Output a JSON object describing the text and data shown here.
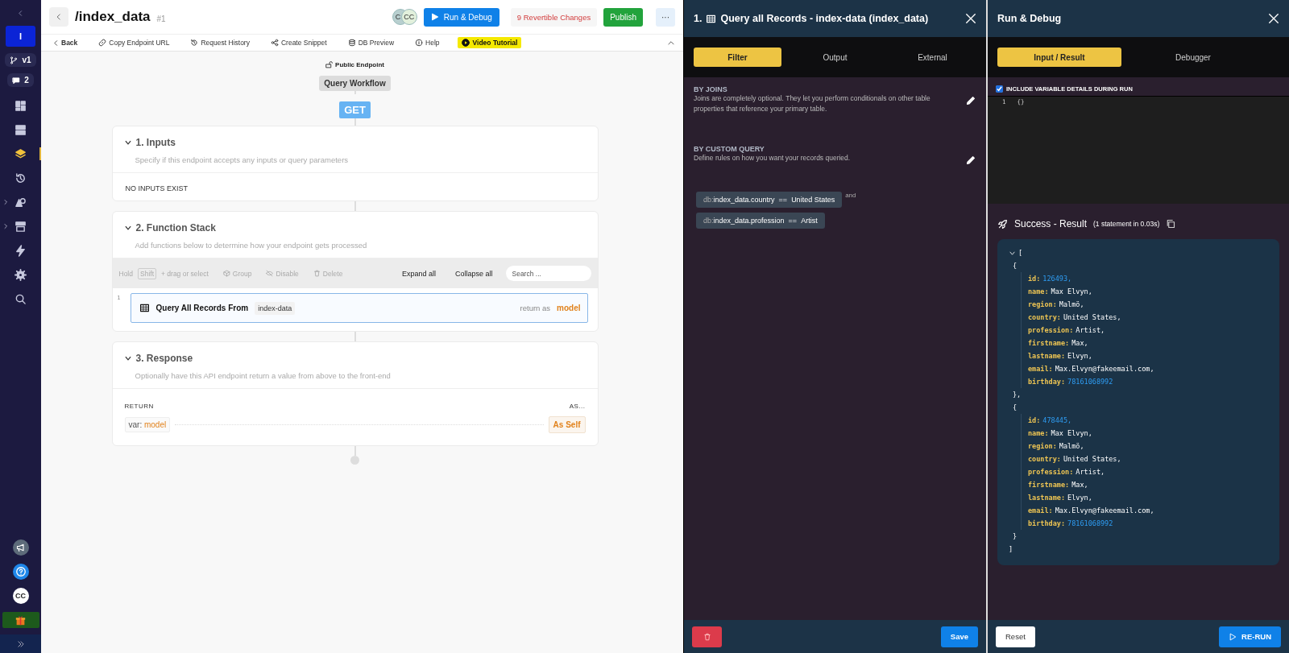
{
  "sidebar": {
    "top": [
      {
        "kind": "workspace",
        "label": "I"
      },
      {
        "kind": "branch",
        "label": "v1"
      },
      {
        "kind": "comments",
        "label": "2"
      }
    ],
    "nav": [
      {
        "selected": false,
        "expandable": false
      },
      {
        "selected": false,
        "expandable": false
      },
      {
        "selected": true,
        "expandable": false
      },
      {
        "selected": false,
        "expandable": false
      },
      {
        "selected": false,
        "expandable": true
      },
      {
        "selected": false,
        "expandable": true
      },
      {
        "selected": false,
        "expandable": false
      },
      {
        "selected": false,
        "expandable": false
      },
      {
        "selected": false,
        "expandable": false
      }
    ],
    "avatar": "CC"
  },
  "header": {
    "title": "/index_data",
    "number": "#1",
    "avatars": [
      "C",
      "CC"
    ],
    "run_button": "Run & Debug",
    "changes": "9 Revertible Changes",
    "publish": "Publish",
    "more": "···"
  },
  "toolbar": [
    {
      "label": "Back",
      "kind": "back"
    },
    {
      "label": "Copy Endpoint URL",
      "kind": "plain"
    },
    {
      "label": "Request History",
      "kind": "plain"
    },
    {
      "label": "Create Snippet",
      "kind": "plain"
    },
    {
      "label": "DB Preview",
      "kind": "plain"
    },
    {
      "label": "Help",
      "kind": "plain"
    },
    {
      "label": "Video Tutorial",
      "kind": "highlight"
    }
  ],
  "workflow": {
    "access": "Public Endpoint",
    "name": "Query Workflow",
    "method": "GET"
  },
  "sections": [
    {
      "kind": "inputs",
      "title": "1. Inputs",
      "description": "Specify if this endpoint accepts any inputs or query parameters",
      "expanded": true,
      "empty_text": "NO INPUTS EXIST"
    },
    {
      "kind": "stack",
      "title": "2. Function Stack",
      "description": "Add functions below to determine how your endpoint gets processed",
      "expanded": true,
      "hold": "Hold",
      "key": "Shift",
      "hint": "+ drag or select",
      "actions": [
        {
          "label": "Group",
          "disabled": true
        },
        {
          "label": "Disable",
          "disabled": true
        },
        {
          "label": "Delete",
          "disabled": true
        }
      ],
      "expand": "Expand all",
      "collapse": "Collapse all",
      "search_placeholder": "Search ...",
      "steps": [
        {
          "number": "1",
          "label": "Query All Records From",
          "table": "index-data",
          "return_label": "return as",
          "return_var": "model",
          "selected": true
        }
      ]
    },
    {
      "kind": "response",
      "title": "3. Response",
      "description": "Optionally have this API endpoint return a value from above to the front-end",
      "expanded": true,
      "return_label": "RETURN",
      "as_label": "AS...",
      "var_prefix": "var:",
      "var": "model",
      "as_value": "As Self"
    }
  ],
  "filter_panel": {
    "step": "1.",
    "title": "Query all Records - index-data (index_data)",
    "tabs": [
      {
        "label": "Filter",
        "selected": true
      },
      {
        "label": "Output",
        "selected": false
      },
      {
        "label": "External",
        "selected": false
      }
    ],
    "groups": [
      {
        "title": "BY JOINS",
        "description": "Joins are completely optional. They let you perform conditionals on other table properties that reference your primary table."
      },
      {
        "title": "BY CUSTOM QUERY",
        "description": "Define rules on how you want your records queried."
      }
    ],
    "conditions": [
      {
        "prefix": "db:",
        "field": "index_data.country",
        "op": "==",
        "value": "United States"
      },
      {
        "prefix": "db:",
        "field": "index_data.profession",
        "op": "==",
        "value": "Artist"
      }
    ],
    "joiner": "and",
    "save": "Save"
  },
  "run_panel": {
    "title": "Run & Debug",
    "tabs": [
      {
        "label": "Input / Result",
        "selected": true
      },
      {
        "label": "Debugger",
        "selected": false
      }
    ],
    "include_vars": {
      "label": "INCLUDE VARIABLE DETAILS DURING RUN",
      "checked": true
    },
    "input_lines": [
      {
        "number": "1",
        "code": "{}"
      }
    ],
    "result": {
      "title": "Success - Result",
      "meta": "(1 statement in 0.03s)",
      "expanded": true,
      "open": "[",
      "close": "]",
      "records": [
        {
          "open": "{",
          "close": "},",
          "fields": [
            {
              "key": "id:",
              "value": "126493,",
              "kind": "number"
            },
            {
              "key": "name:",
              "value": "Max Elvyn,",
              "kind": "string"
            },
            {
              "key": "region:",
              "value": "Malmö,",
              "kind": "string"
            },
            {
              "key": "country:",
              "value": "United States,",
              "kind": "string"
            },
            {
              "key": "profession:",
              "value": "Artist,",
              "kind": "string"
            },
            {
              "key": "firstname:",
              "value": "Max,",
              "kind": "string"
            },
            {
              "key": "lastname:",
              "value": "Elvyn,",
              "kind": "string"
            },
            {
              "key": "email:",
              "value": "Max.Elvyn@fakeemail.com,",
              "kind": "string"
            },
            {
              "key": "birthday:",
              "value": "78161068992",
              "kind": "number"
            }
          ]
        },
        {
          "open": "{",
          "close": "}",
          "fields": [
            {
              "key": "id:",
              "value": "478445,",
              "kind": "number"
            },
            {
              "key": "name:",
              "value": "Max Elvyn,",
              "kind": "string"
            },
            {
              "key": "region:",
              "value": "Malmö,",
              "kind": "string"
            },
            {
              "key": "country:",
              "value": "United States,",
              "kind": "string"
            },
            {
              "key": "profession:",
              "value": "Artist,",
              "kind": "string"
            },
            {
              "key": "firstname:",
              "value": "Max,",
              "kind": "string"
            },
            {
              "key": "lastname:",
              "value": "Elvyn,",
              "kind": "string"
            },
            {
              "key": "email:",
              "value": "Max.Elvyn@fakeemail.com,",
              "kind": "string"
            },
            {
              "key": "birthday:",
              "value": "78161068992",
              "kind": "number"
            }
          ]
        }
      ]
    },
    "reset": "Reset",
    "rerun": "RE-RUN"
  }
}
